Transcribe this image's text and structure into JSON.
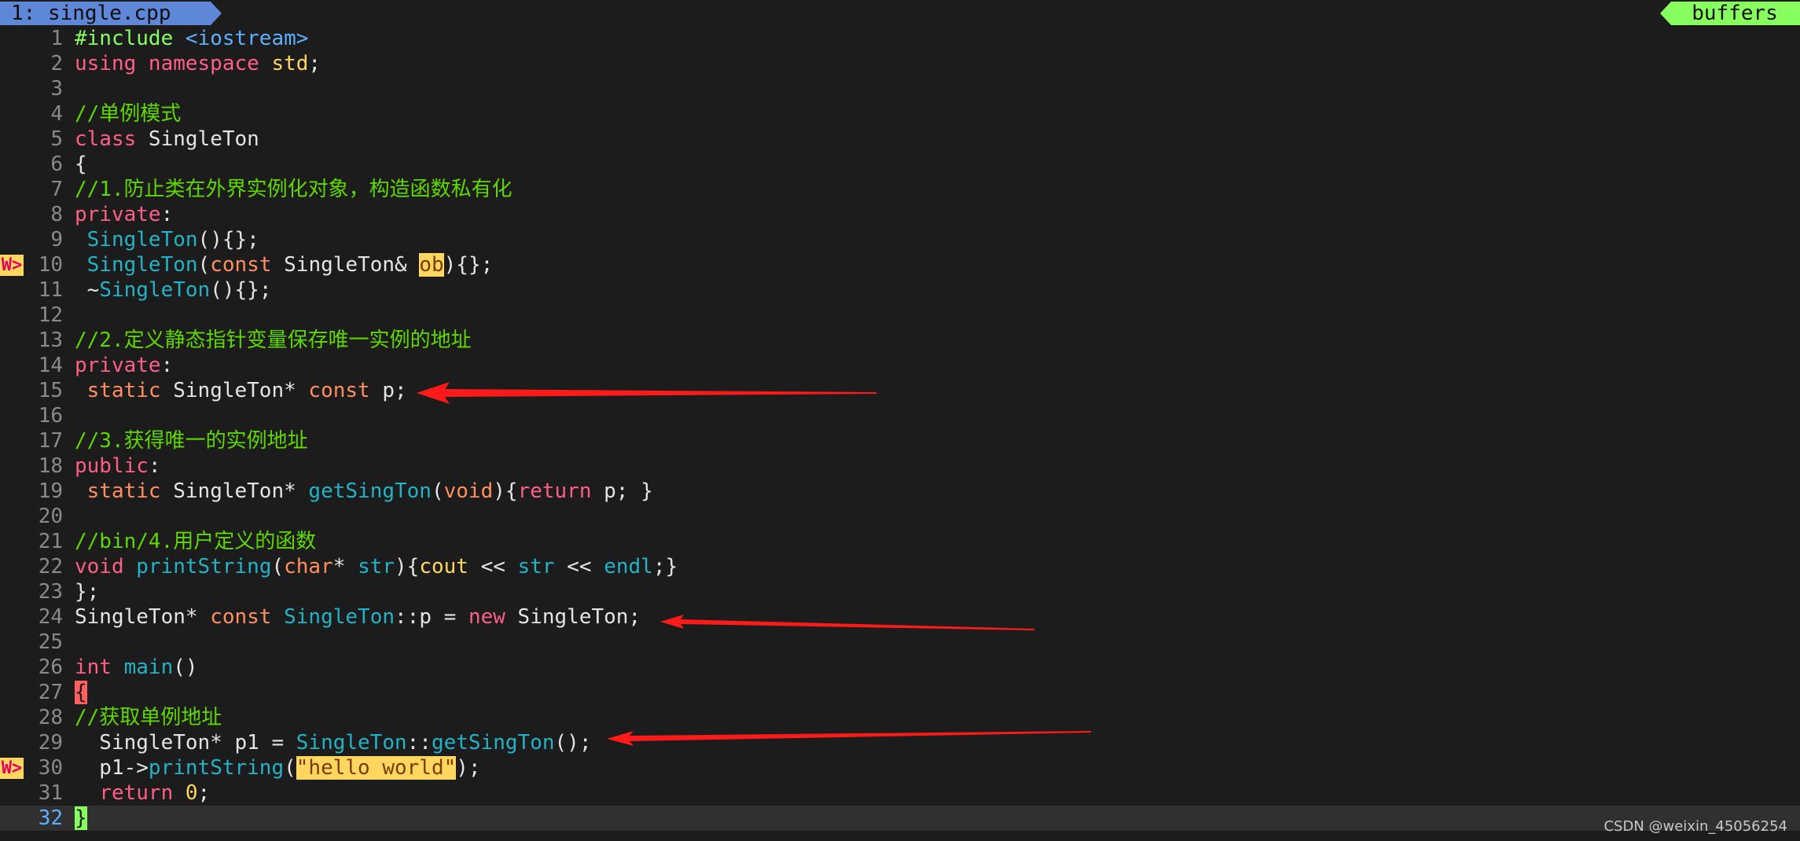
{
  "tabline": {
    "active_tab": "1: single.cpp",
    "right_label": "buffers"
  },
  "sign_text": "W>",
  "lines": [
    {
      "n": "1",
      "tokens": [
        [
          "#include ",
          "pre"
        ],
        [
          "<iostream>",
          "inc"
        ]
      ]
    },
    {
      "n": "2",
      "tokens": [
        [
          "using namespace ",
          "kw"
        ],
        [
          "std",
          "std"
        ],
        [
          ";",
          ""
        ]
      ]
    },
    {
      "n": "3",
      "tokens": []
    },
    {
      "n": "4",
      "tokens": [
        [
          "//单例模式",
          "cmt"
        ]
      ]
    },
    {
      "n": "5",
      "tokens": [
        [
          "class ",
          "kw"
        ],
        [
          "SingleTon",
          ""
        ]
      ]
    },
    {
      "n": "6",
      "tokens": [
        [
          "{",
          ""
        ]
      ]
    },
    {
      "n": "7",
      "tokens": [
        [
          "//1.防止类在外界实例化对象，构造函数私有化",
          "cmt"
        ]
      ]
    },
    {
      "n": "8",
      "tokens": [
        [
          "private",
          "kw"
        ],
        [
          ":",
          ""
        ]
      ]
    },
    {
      "n": "9",
      "tokens": [
        [
          " ",
          ""
        ],
        [
          "SingleTon",
          "fn"
        ],
        [
          "(){};",
          ""
        ]
      ]
    },
    {
      "n": "10",
      "sign": true,
      "tokens": [
        [
          " ",
          ""
        ],
        [
          "SingleTon",
          "fn"
        ],
        [
          "(",
          ""
        ],
        [
          "const",
          "type"
        ],
        [
          " SingleTon& ",
          ""
        ],
        [
          "ob",
          "hl"
        ],
        [
          "){};",
          ""
        ]
      ]
    },
    {
      "n": "11",
      "tokens": [
        [
          " ~",
          ""
        ],
        [
          "SingleTon",
          "fn"
        ],
        [
          "(){};",
          ""
        ]
      ]
    },
    {
      "n": "12",
      "tokens": []
    },
    {
      "n": "13",
      "tokens": [
        [
          "//2.定义静态指针变量保存唯一实例的地址",
          "cmt"
        ]
      ]
    },
    {
      "n": "14",
      "tokens": [
        [
          "private",
          "kw"
        ],
        [
          ":",
          ""
        ]
      ]
    },
    {
      "n": "15",
      "tokens": [
        [
          " ",
          ""
        ],
        [
          "static",
          "type"
        ],
        [
          " SingleTon* ",
          ""
        ],
        [
          "const",
          "type"
        ],
        [
          " p;",
          ""
        ]
      ]
    },
    {
      "n": "16",
      "tokens": []
    },
    {
      "n": "17",
      "tokens": [
        [
          "//3.获得唯一的实例地址",
          "cmt"
        ]
      ]
    },
    {
      "n": "18",
      "tokens": [
        [
          "public",
          "kw"
        ],
        [
          ":",
          ""
        ]
      ]
    },
    {
      "n": "19",
      "tokens": [
        [
          " ",
          ""
        ],
        [
          "static",
          "type"
        ],
        [
          " SingleTon* ",
          ""
        ],
        [
          "getSingTon",
          "fn"
        ],
        [
          "(",
          ""
        ],
        [
          "void",
          "type"
        ],
        [
          "){",
          ""
        ],
        [
          "return",
          "kw"
        ],
        [
          " p; }",
          ""
        ]
      ]
    },
    {
      "n": "20",
      "tokens": []
    },
    {
      "n": "21",
      "tokens": [
        [
          "//bin/4.用户定义的函数",
          "cmt"
        ]
      ]
    },
    {
      "n": "22",
      "tokens": [
        [
          "void",
          "kw"
        ],
        [
          " ",
          ""
        ],
        [
          "printString",
          "fn"
        ],
        [
          "(",
          ""
        ],
        [
          "char",
          "type"
        ],
        [
          "* ",
          ""
        ],
        [
          "str",
          "fn"
        ],
        [
          "){",
          ""
        ],
        [
          "cout",
          "std"
        ],
        [
          " << ",
          ""
        ],
        [
          "str",
          "fn"
        ],
        [
          " << ",
          ""
        ],
        [
          "endl",
          "fn"
        ],
        [
          ";}",
          ""
        ]
      ]
    },
    {
      "n": "23",
      "tokens": [
        [
          "};",
          ""
        ]
      ]
    },
    {
      "n": "24",
      "tokens": [
        [
          "SingleTon* ",
          ""
        ],
        [
          "const",
          "type"
        ],
        [
          " ",
          ""
        ],
        [
          "SingleTon",
          "fn"
        ],
        [
          "::p = ",
          ""
        ],
        [
          "new",
          "kw"
        ],
        [
          " SingleTon;",
          ""
        ]
      ]
    },
    {
      "n": "25",
      "tokens": []
    },
    {
      "n": "26",
      "tokens": [
        [
          "int",
          "kw"
        ],
        [
          " ",
          ""
        ],
        [
          "main",
          "fn"
        ],
        [
          "()",
          ""
        ]
      ]
    },
    {
      "n": "27",
      "tokens": [
        [
          "{",
          "cur"
        ]
      ]
    },
    {
      "n": "28",
      "tokens": [
        [
          "//获取单例地址",
          "cmt"
        ]
      ]
    },
    {
      "n": "29",
      "tokens": [
        [
          "  SingleTon* p1 = ",
          ""
        ],
        [
          "SingleTon",
          "fn"
        ],
        [
          "::",
          ""
        ],
        [
          "getSingTon",
          "fn"
        ],
        [
          "();",
          ""
        ]
      ]
    },
    {
      "n": "30",
      "sign": true,
      "tokens": [
        [
          "  p1->",
          ""
        ],
        [
          "printString",
          "fn"
        ],
        [
          "(",
          ""
        ],
        [
          "\"hello world\"",
          "hlstr"
        ],
        [
          ");",
          ""
        ]
      ]
    },
    {
      "n": "31",
      "tokens": [
        [
          "  ",
          ""
        ],
        [
          "return",
          "kw"
        ],
        [
          " ",
          ""
        ],
        [
          "0",
          "num"
        ],
        [
          ";",
          ""
        ]
      ]
    },
    {
      "n": "32",
      "cursorline": true,
      "tokens": [
        [
          "}",
          "curend"
        ]
      ]
    }
  ],
  "annotations": [
    {
      "name": "red-arrow-line-15",
      "target_line": "15"
    },
    {
      "name": "red-arrow-line-24",
      "target_line": "24"
    },
    {
      "name": "red-arrow-line-29",
      "target_line": "29"
    }
  ],
  "watermark": "CSDN @weixin_45056254",
  "colors": {
    "background": "#1c1c1c",
    "tab_active": "#5f87d7",
    "tab_buffers": "#87ff5f",
    "keyword": "#ff5f87",
    "function": "#22b3c7",
    "comment": "#5fd700",
    "type": "#ff8f5f",
    "highlight": "#ffd75f",
    "arrow": "#ff1a1a"
  }
}
